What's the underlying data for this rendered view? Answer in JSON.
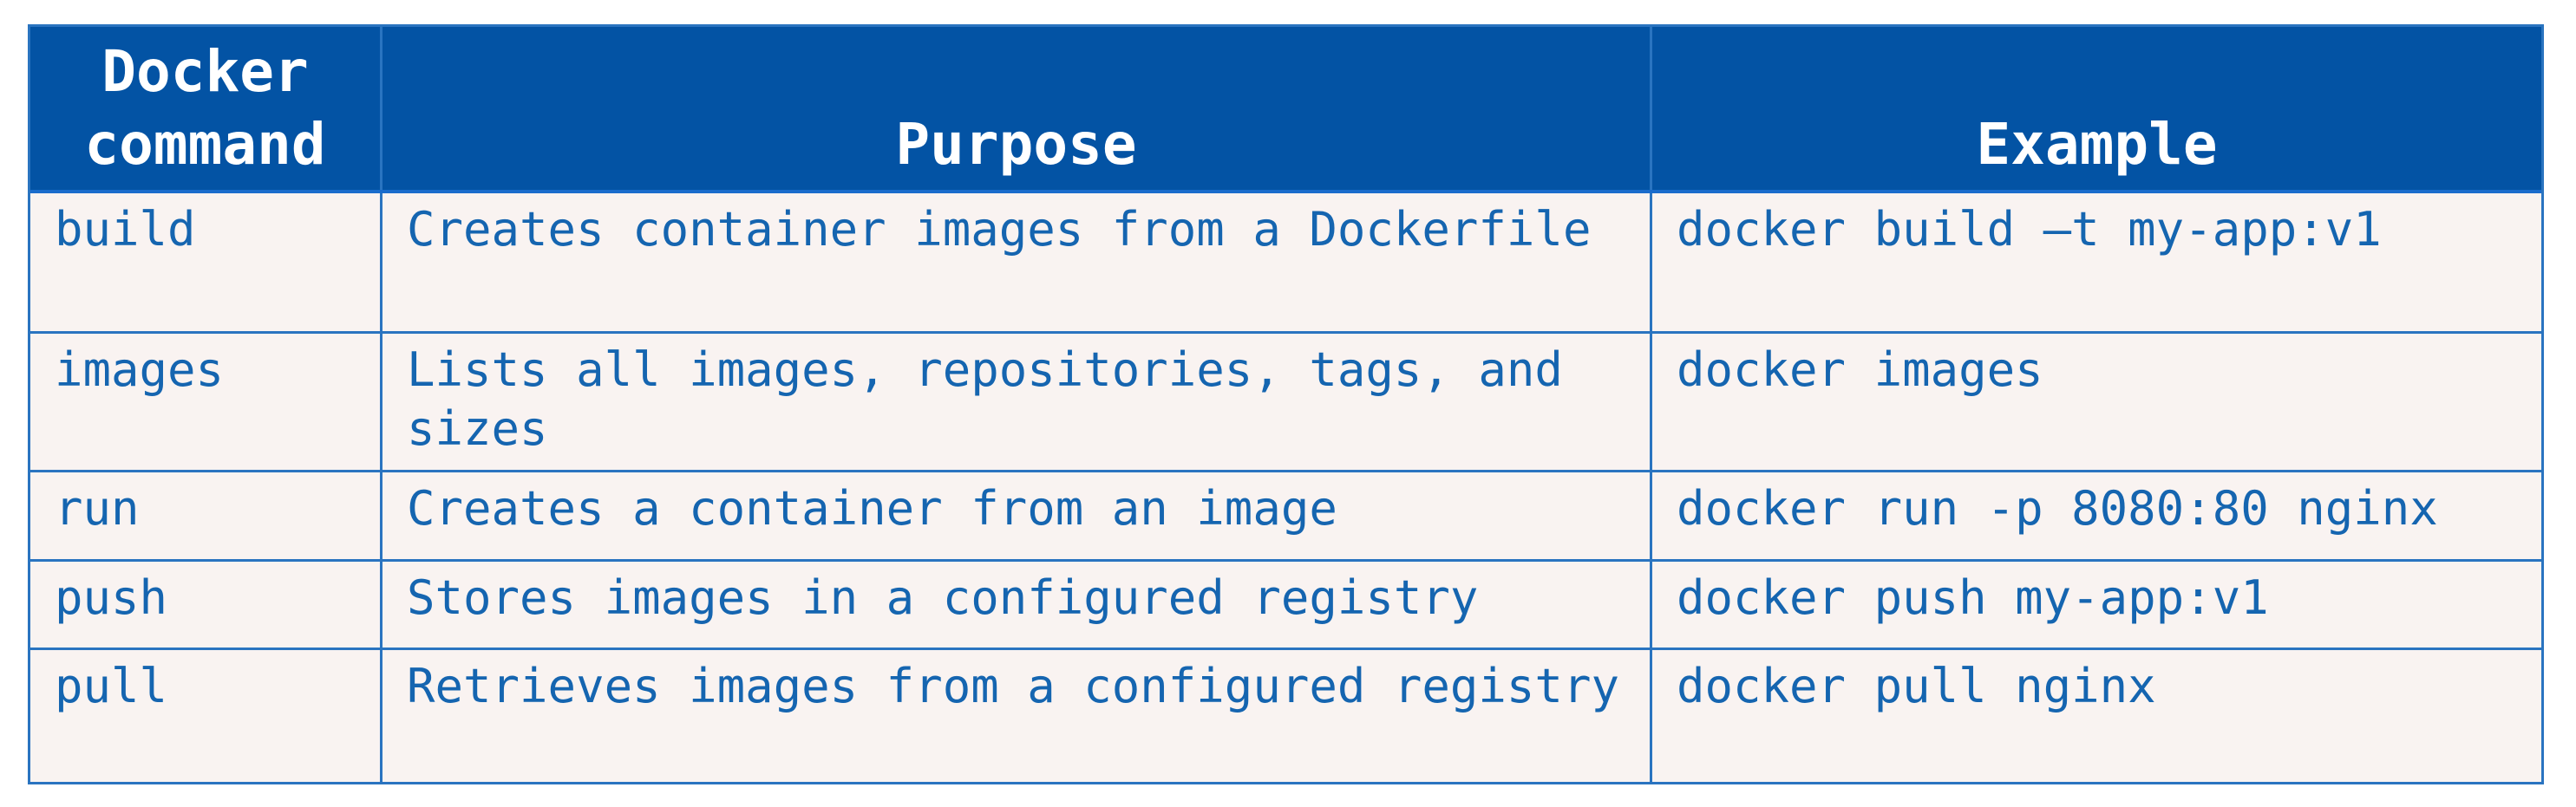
{
  "table": {
    "headers": {
      "command": "Docker\ncommand",
      "purpose": "Purpose",
      "example": "Example"
    },
    "rows": [
      {
        "command": "build",
        "purpose": "Creates container images from a Dockerfile",
        "example": "docker build –t my-app:v1"
      },
      {
        "command": "images",
        "purpose": "Lists all images, repositories, tags, and sizes",
        "example": "docker images"
      },
      {
        "command": "run",
        "purpose": "Creates a container from an image",
        "example": "docker run -p 8080:80 nginx"
      },
      {
        "command": "push",
        "purpose": "Stores images in a configured registry",
        "example": "docker push my-app:v1"
      },
      {
        "command": "pull",
        "purpose": "Retrieves images from a configured registry",
        "example": "docker pull nginx"
      }
    ]
  },
  "colors": {
    "header_bg": "#0353a4",
    "header_text": "#ffffff",
    "body_bg": "#f9f3f1",
    "body_text": "#1565b0",
    "border": "#2a74c0"
  }
}
